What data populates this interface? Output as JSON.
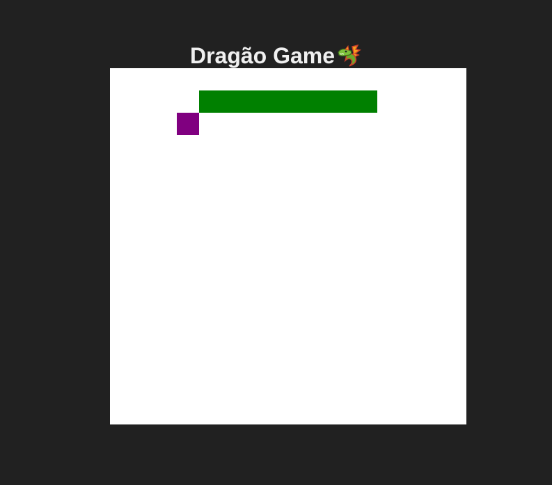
{
  "title": "Dragão Game",
  "title_icon": "dragon-icon",
  "colors": {
    "background": "#212121",
    "board": "#ffffff",
    "dragon_body": "#008000",
    "food": "#800080",
    "title_text": "#f0f0f0"
  },
  "grid": {
    "columns": 16,
    "rows": 16
  },
  "dragon": {
    "segments": [
      {
        "col": 4,
        "row": 1
      },
      {
        "col": 5,
        "row": 1
      },
      {
        "col": 6,
        "row": 1
      },
      {
        "col": 7,
        "row": 1
      },
      {
        "col": 8,
        "row": 1
      },
      {
        "col": 9,
        "row": 1
      },
      {
        "col": 10,
        "row": 1
      },
      {
        "col": 11,
        "row": 1
      }
    ]
  },
  "food": {
    "col": 3,
    "row": 2
  }
}
